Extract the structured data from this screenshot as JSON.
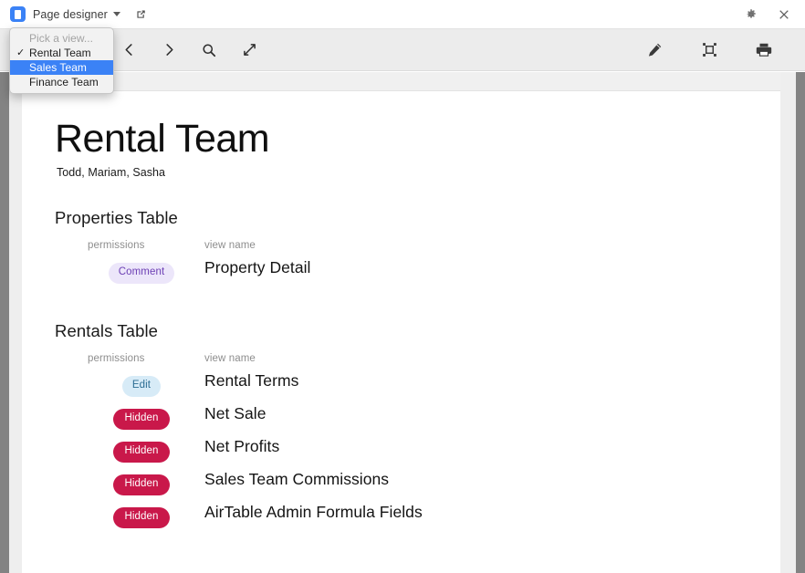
{
  "window": {
    "app_icon": "document-icon",
    "title": "Page designer",
    "caret": "chevron-down-icon",
    "external_link_icon": "external-link-icon",
    "settings_icon": "gear-icon",
    "close_icon": "close-icon"
  },
  "toolbar": {
    "left_items": [
      {
        "name": "back-button",
        "icon": "chevron-left-icon"
      },
      {
        "name": "forward-button",
        "icon": "chevron-right-icon"
      },
      {
        "name": "search-button",
        "icon": "search-icon"
      },
      {
        "name": "expand-button",
        "icon": "expand-arrows-icon"
      }
    ],
    "right_items": [
      {
        "name": "edit-button",
        "icon": "pencil-icon"
      },
      {
        "name": "frame-button",
        "icon": "crop-frame-icon"
      },
      {
        "name": "print-button",
        "icon": "printer-icon"
      }
    ]
  },
  "view_menu": {
    "placeholder": "Pick a view...",
    "items": [
      {
        "label": "Rental Team",
        "checked": true,
        "highlighted": false
      },
      {
        "label": "Sales Team",
        "checked": false,
        "highlighted": true
      },
      {
        "label": "Finance Team",
        "checked": false,
        "highlighted": false
      }
    ],
    "check_glyph": "✓"
  },
  "document": {
    "title": "Rental Team",
    "subtitle": "Todd, Mariam, Sasha",
    "columns": {
      "permissions": "permissions",
      "view_name": "view name"
    },
    "sections": [
      {
        "title": "Properties Table",
        "rows": [
          {
            "permission": "Comment",
            "permission_style": "comment",
            "view_name": "Property Detail"
          }
        ]
      },
      {
        "title": "Rentals Table",
        "rows": [
          {
            "permission": "Edit",
            "permission_style": "edit",
            "view_name": "Rental Terms"
          },
          {
            "permission": "Hidden",
            "permission_style": "hidden",
            "view_name": "Net Sale"
          },
          {
            "permission": "Hidden",
            "permission_style": "hidden",
            "view_name": "Net Profits"
          },
          {
            "permission": "Hidden",
            "permission_style": "hidden",
            "view_name": "Sales Team Commissions"
          },
          {
            "permission": "Hidden",
            "permission_style": "hidden",
            "view_name": "AirTable Admin Formula Fields"
          }
        ]
      }
    ]
  },
  "colors": {
    "accent": "#3b82f6",
    "badge_hidden_bg": "#c9184a",
    "badge_edit_bg": "#d7ebf7",
    "badge_comment_bg": "#ece6fa",
    "toolbar_bg": "#ececec"
  }
}
